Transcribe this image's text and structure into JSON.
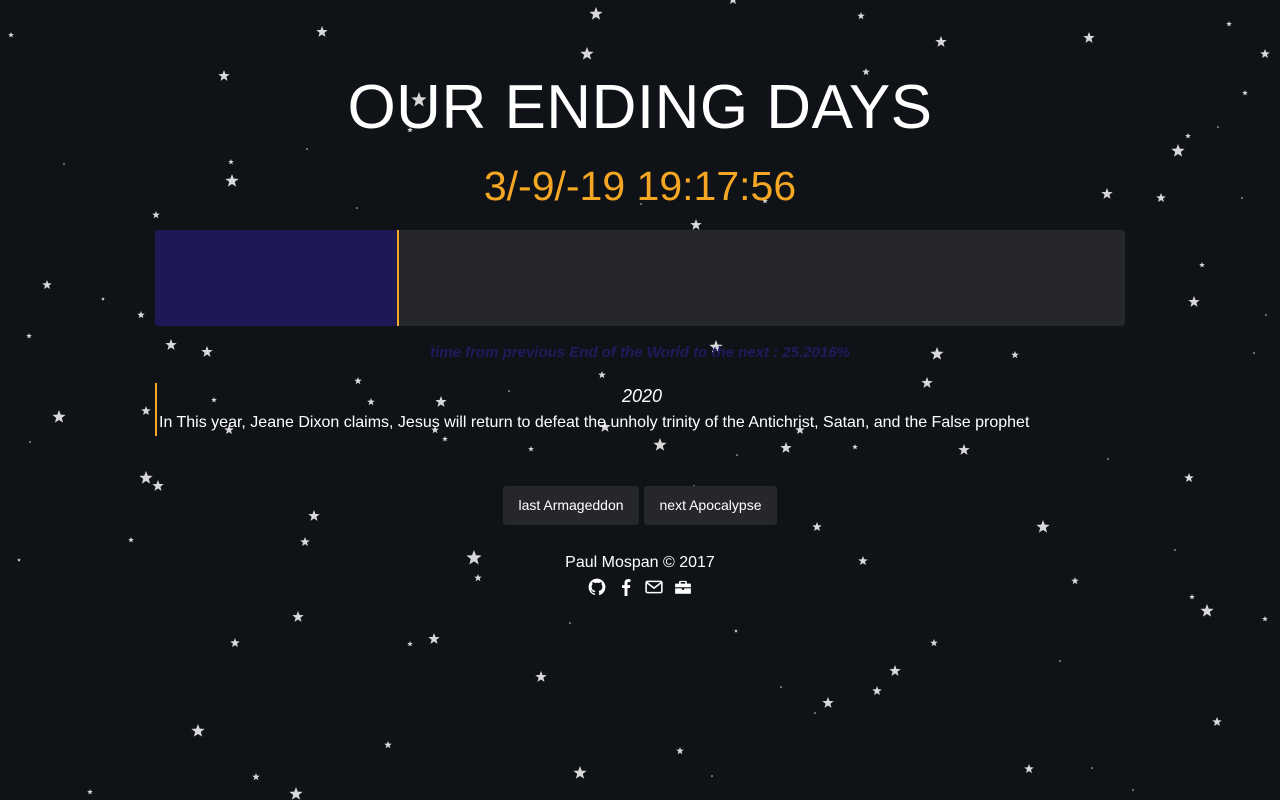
{
  "header": {
    "title": "OUR ENDING DAYS",
    "countdown": "3/-9/-19 19:17:56"
  },
  "progress": {
    "percent": 25.2016,
    "caption": "time from previous End of the World to the next : 25.2016%"
  },
  "event": {
    "year": "2020",
    "description": "In This year, Jeane Dixon claims, Jesus will return to defeat the unholy trinity of the Antichrist, Satan, and the False prophet"
  },
  "buttons": {
    "last_label": "last Armageddon",
    "next_label": "next Apocalypse"
  },
  "footer": {
    "credit": "Paul Mospan © 2017",
    "social_icons": [
      "github-icon",
      "facebook-icon",
      "envelope-icon",
      "briefcase-icon"
    ]
  },
  "colors": {
    "background": "#0f1217",
    "accent": "#f5a623",
    "progress_fill": "#1c1955",
    "progress_track": "#25272c",
    "star": "#d8d8d8"
  }
}
